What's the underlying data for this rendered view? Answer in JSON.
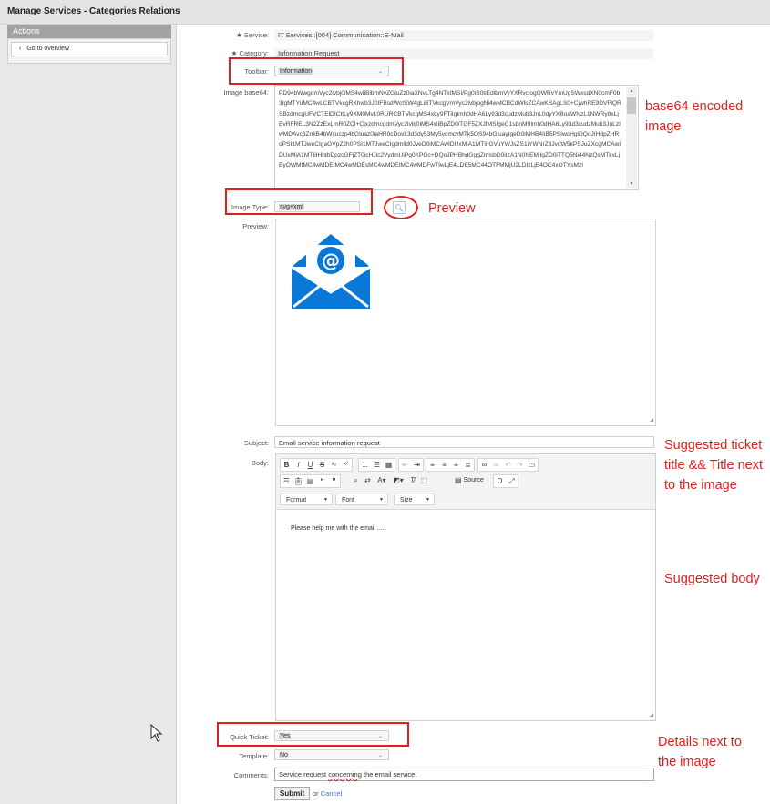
{
  "page": {
    "title": "Manage Services - Categories Relations"
  },
  "sidebar": {
    "actions_title": "Actions",
    "go_to_overview": "Go to overview"
  },
  "form": {
    "service": {
      "label": "Service:",
      "value": "IT Services::[004] Communication::E-Mail"
    },
    "category": {
      "label": "Category:",
      "value": "Information Request"
    },
    "toolbar": {
      "label": "Toolbar:",
      "value": "Information"
    },
    "image_base64": {
      "label": "Image base64:",
      "value": "PD94bWwgdmVyc2lvbj0iMS4wIiBlbmNvZGluZz0iaXNvLTg4NTktMSI/Pg0iS0tiEdlbmVyYXRvcjogQWRvYmUgSWxsdXN0cmF0b3IgMTYuMC4wLCBTVkcgRXhwb3J0IFBsdWctSW4gLiBTVkcgVmVyc2lvbjogNi4wMCBCdWlsZCAwKSAgLS0+CjwhRE9DVFlQRSBzdmcgUFVCTElDICItLy9XM0MvL0RURCBTVkcgMS4xLy9FTiIgImh0dHA6Ly93d3cudzMub3JnL0dyYXBoaWNzL1NWRy8xLjEvRFREL3N2ZzExLmR0ZCI+CjxzdmcgdmVyc2lvbj0iMS4xIiBpZD0iTGF5ZXJfMSIgeG1sbnM9Imh0dHA6Ly93d3cudzMub3JnLzIwMDAvc3ZnIiB4bWxuczp4bGluaz0iaHR0cDovL3d3dy53My5vcmcvMTk5OS94bGluayIgeD0iMHB4IiB5PSIwcHgiDQoJIHdpZHRoPSI1MTJweCIgaGVpZ2h0PSI1MTJweCIgdmlld0JveD0iMCAwIDUxMiA1MTIiIGVuYWJsZS1iYWNrZ3JvdW5kPSJuZXcgMCAwIDUxMiA1MTIiIHhtbDpzcGFjZT0icHJlc2VydmUiPg0KPGc+DQoJPHBhdGggZmlsbD0iIzA1N0NEMiIgZD0iTTQ5Ni44NzQsMTkxLjEyOWMtMC4wMDEtMC4wMDEsMC4wMDEtMC4wMDFwTIwLjE4LDE5MC44OTFMMjU2LDIzLjE4OC4xOTYsMzI"
    },
    "image_type": {
      "label": "Image Type:",
      "value": "svg+xml"
    },
    "preview": {
      "label": "Preview:"
    },
    "subject": {
      "label": "Subject:",
      "value": "Email service information request"
    },
    "body": {
      "label": "Body:",
      "text": "Please help me with the email ....."
    },
    "editor": {
      "format": "Format",
      "font": "Font",
      "size": "Size",
      "source": "Source"
    },
    "quick_ticket": {
      "label": "Quick Ticket:",
      "value": "Yes"
    },
    "template": {
      "label": "Template:",
      "value": "No"
    },
    "comments": {
      "label": "Comments:",
      "value_prefix": "Service request ",
      "value_spell": "concerning",
      "value_suffix": " the email service."
    },
    "submit": "Submit",
    "or": "or",
    "cancel": "Cancel"
  },
  "annotations": {
    "base64": "base64  encoded image",
    "preview": "Preview",
    "title": "Suggested ticket title && Title next to the image",
    "body": "Suggested body",
    "details": "Details next to the image"
  },
  "colors": {
    "annotation": "#e02020",
    "envelope": "#0a78d7",
    "link": "#3a76b8"
  }
}
